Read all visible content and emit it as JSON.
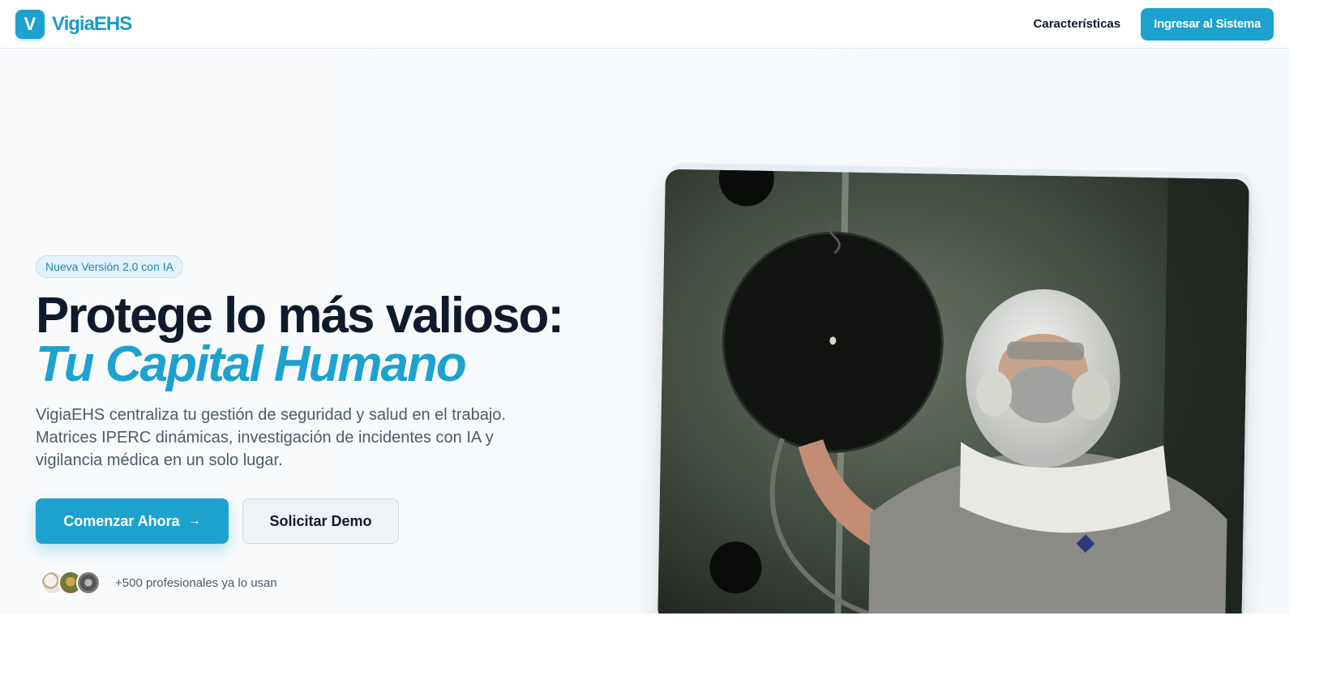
{
  "brand": {
    "logo_letter": "V",
    "name": "VigiaEHS",
    "color": "#1da2cf"
  },
  "nav": {
    "link_label": "Características",
    "login_label": "Ingresar al Sistema"
  },
  "hero": {
    "badge": "Nueva Versión 2.0 con IA",
    "headline_line1": "Protege lo más valioso:",
    "headline_line2": "Tu Capital Humano",
    "subtitle": "VigiaEHS centraliza tu gestión de seguridad y salud en el trabajo. Matrices IPERC dinámicas, investigación de incidentes con IA y vigilancia médica en un solo lugar.",
    "primary_cta": "Comenzar Ahora",
    "primary_cta_icon": "arrow-right-icon",
    "secondary_cta": "Solicitar Demo",
    "social_proof": "+500 profesionales ya lo usan"
  }
}
